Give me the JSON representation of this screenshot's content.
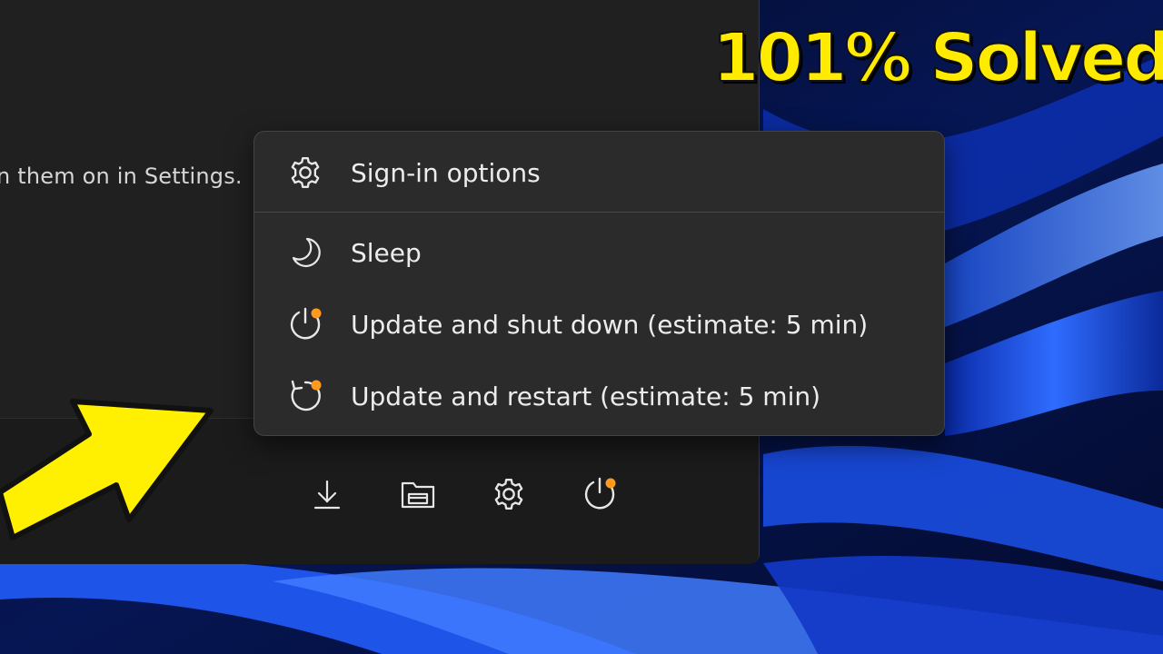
{
  "overlay": {
    "headline": "101% Solved",
    "headline_color": "#ffeb00",
    "arrow_color": "#ffef00"
  },
  "start_panel": {
    "truncated_text": "n them on in Settings."
  },
  "power_menu": {
    "items": [
      {
        "label": "Sign-in options",
        "icon": "gear-icon"
      },
      {
        "label": "Sleep",
        "icon": "moon-icon"
      },
      {
        "label": "Update and shut down (estimate: 5 min)",
        "icon": "power-update-icon"
      },
      {
        "label": "Update and restart (estimate: 5 min)",
        "icon": "restart-update-icon"
      }
    ],
    "update_dot_color": "#ff9a1f"
  },
  "footer": {
    "buttons": [
      {
        "icon": "download-icon"
      },
      {
        "icon": "folder-icon"
      },
      {
        "icon": "settings-icon"
      },
      {
        "icon": "power-icon"
      }
    ]
  }
}
